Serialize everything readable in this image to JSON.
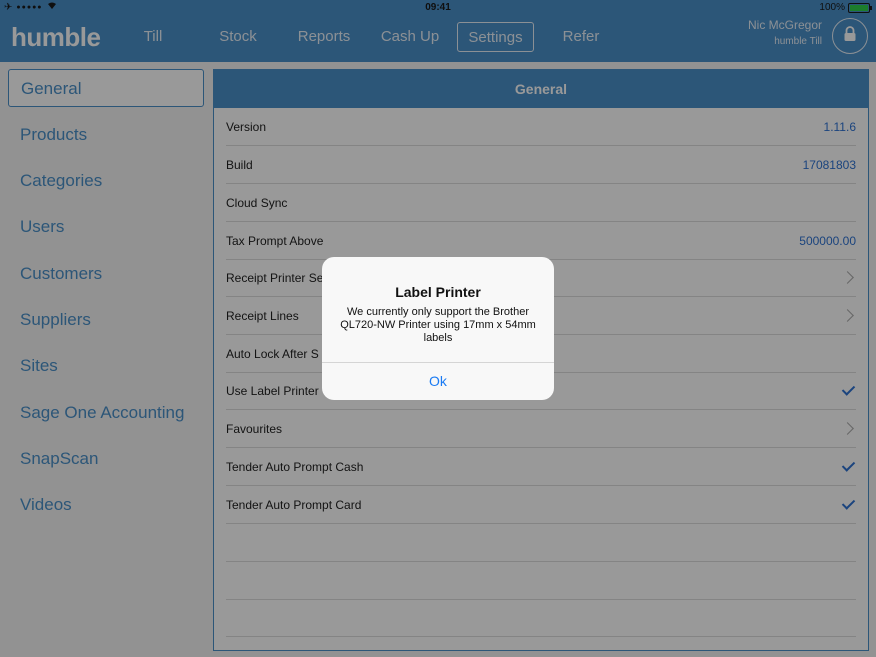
{
  "status_bar": {
    "time": "09:41",
    "battery": "100%"
  },
  "nav": {
    "logo": "humble",
    "items": [
      "Till",
      "Stock",
      "Reports",
      "Cash Up",
      "Settings",
      "Refer"
    ],
    "active": "Settings",
    "user_name": "Nic McGregor",
    "user_sub": "humble Till"
  },
  "sidebar": {
    "items": [
      "General",
      "Products",
      "Categories",
      "Users",
      "Customers",
      "Suppliers",
      "Sites",
      "Sage One Accounting",
      "SnapScan",
      "Videos"
    ],
    "active": "General"
  },
  "main": {
    "header": "General",
    "rows": [
      {
        "label": "Version",
        "value": "1.11.6"
      },
      {
        "label": "Build",
        "value": "17081803"
      },
      {
        "label": "Cloud Sync",
        "value": ""
      },
      {
        "label": "Tax Prompt Above",
        "value": "500000.00"
      },
      {
        "label": "Receipt Printer Se",
        "value": ""
      },
      {
        "label": "Receipt Lines",
        "value": ""
      },
      {
        "label": "Auto Lock After S",
        "value": ""
      },
      {
        "label": "Use Label Printer",
        "value": ""
      },
      {
        "label": "Favourites",
        "value": ""
      },
      {
        "label": "Tender Auto Prompt Cash",
        "value": ""
      },
      {
        "label": "Tender Auto Prompt Card",
        "value": ""
      }
    ]
  },
  "alert": {
    "title": "Label Printer",
    "message": "We currently only support the Brother QL720-NW Printer using 17mm x 54mm labels",
    "button": "Ok"
  },
  "colors": {
    "accent": "#4a8fc8",
    "link": "#2e72d2",
    "ok_button": "#1a7bf3"
  },
  "icons": [
    "airplane-icon",
    "signal-icon",
    "wifi-icon",
    "battery-icon",
    "lock-icon",
    "chevron-right-icon",
    "checkmark-icon"
  ]
}
